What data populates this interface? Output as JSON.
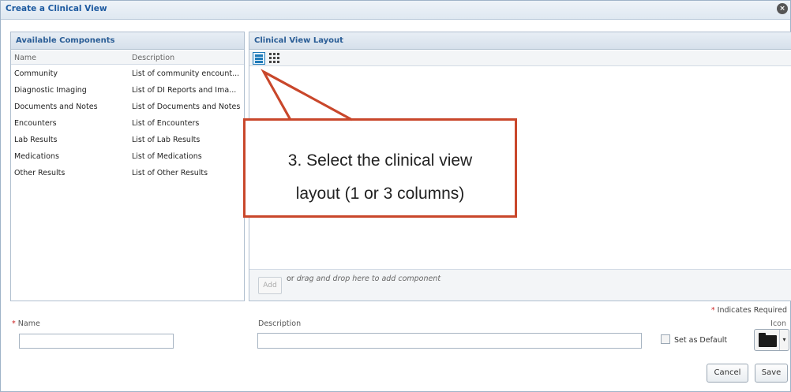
{
  "dialog": {
    "title": "Create a Clinical View",
    "close_symbol": "×"
  },
  "left_panel": {
    "title": "Available Components",
    "columns": [
      "Name",
      "Description"
    ],
    "items": [
      {
        "name": "Community",
        "description": "List of community encount..."
      },
      {
        "name": "Diagnostic Imaging",
        "description": "List of DI Reports and Ima..."
      },
      {
        "name": "Documents and Notes",
        "description": "List of Documents and Notes"
      },
      {
        "name": "Encounters",
        "description": "List of Encounters"
      },
      {
        "name": "Lab Results",
        "description": "List of Lab Results"
      },
      {
        "name": "Medications",
        "description": "List of Medications"
      },
      {
        "name": "Other Results",
        "description": "List of Other Results"
      }
    ]
  },
  "right_panel": {
    "title": "Clinical View Layout",
    "add_button": "Add",
    "drag_or": "or",
    "drag_text": "drag and drop here to add component"
  },
  "form": {
    "required_star": "*",
    "required_note": "Indicates Required",
    "name_label": "Name",
    "name_value": "",
    "description_label": "Description",
    "description_value": "",
    "default_label": "Set as Default",
    "default_checked": false,
    "icon_label": "Icon",
    "icon_value": "folder-icon",
    "caret": "▾"
  },
  "buttons": {
    "cancel": "Cancel",
    "save": "Save"
  },
  "callout": {
    "line1": "3. Select the clinical view",
    "line2": "layout (1 or 3 columns)",
    "border_color": "#c9472b"
  }
}
